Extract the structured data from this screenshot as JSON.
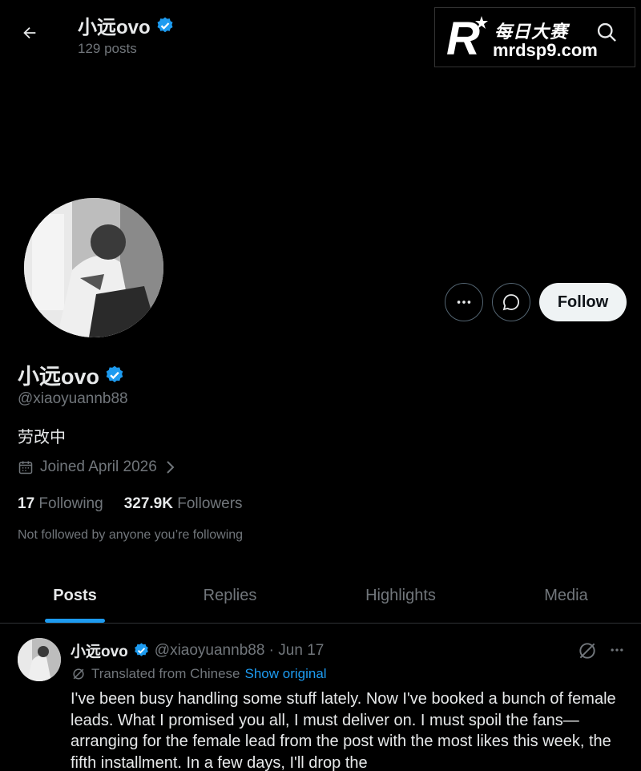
{
  "header": {
    "name": "小远ovo",
    "posts_count": "129 posts"
  },
  "watermark": {
    "logo_text": "R",
    "cn_text": "每日大赛",
    "url": "mrdsp9.com"
  },
  "profile": {
    "display_name": "小远ovo",
    "handle": "@xiaoyuannb88",
    "bio": "劳改中",
    "joined": "Joined April 2026",
    "following_count": "17",
    "following_label": "Following",
    "followers_count": "327.9K",
    "followers_label": "Followers",
    "not_followed": "Not followed by anyone you’re following"
  },
  "actions": {
    "follow_label": "Follow"
  },
  "tabs": [
    {
      "label": "Posts",
      "active": true
    },
    {
      "label": "Replies",
      "active": false
    },
    {
      "label": "Highlights",
      "active": false
    },
    {
      "label": "Media",
      "active": false
    }
  ],
  "post": {
    "name": "小远ovo",
    "handle_date": "@xiaoyuannb88 · Jun 17",
    "translated_label": "Translated from Chinese",
    "show_original": "Show original",
    "text": "I've been busy handling some stuff lately. Now I've booked a bunch of female leads. What I promised you all, I must deliver on. I must spoil the fans—arranging for the female lead from the post with the most likes this week, the fifth installment. In a few days, I'll drop the"
  },
  "colors": {
    "background": "#000000",
    "accent": "#1d9bf0",
    "text_primary": "#e7e9ea",
    "text_secondary": "#71767b"
  },
  "icons": [
    "back-arrow-icon",
    "verified-badge-icon",
    "search-icon",
    "more-icon",
    "message-icon",
    "calendar-icon",
    "chevron-right-icon",
    "grok-icon",
    "translate-icon"
  ]
}
